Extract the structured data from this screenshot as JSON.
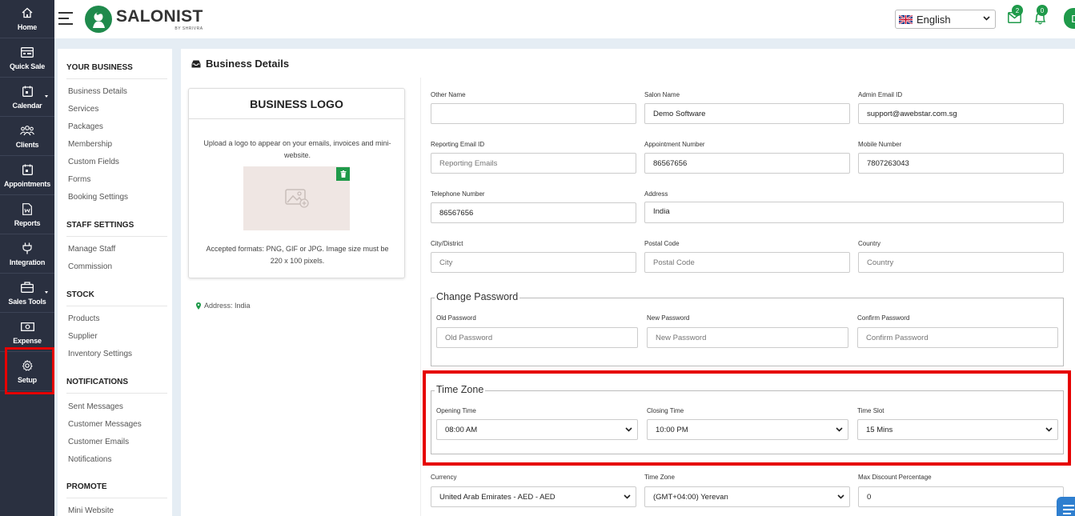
{
  "nav": {
    "items": [
      {
        "label": "Home",
        "icon": "home-icon"
      },
      {
        "label": "Quick Sale",
        "icon": "cash-register-icon"
      },
      {
        "label": "Calendar",
        "icon": "calendar-icon"
      },
      {
        "label": "Clients",
        "icon": "users-icon"
      },
      {
        "label": "Appointments",
        "icon": "appointment-icon"
      },
      {
        "label": "Reports",
        "icon": "report-icon"
      },
      {
        "label": "Integration",
        "icon": "plug-icon"
      },
      {
        "label": "Sales Tools",
        "icon": "briefcase-icon"
      },
      {
        "label": "Expense",
        "icon": "money-icon"
      },
      {
        "label": "Setup",
        "icon": "gear-icon"
      }
    ]
  },
  "header": {
    "logo_name": "SALONIST",
    "logo_sub": "BY SHRIVRA",
    "language": "English",
    "mail_count": "2",
    "notification_count": "0",
    "avatar_initial": "D"
  },
  "sidebar": {
    "sections": [
      {
        "title": "YOUR BUSINESS",
        "links": [
          "Business Details",
          "Services",
          "Packages",
          "Membership",
          "Custom Fields",
          "Forms",
          "Booking Settings"
        ]
      },
      {
        "title": "STAFF SETTINGS",
        "links": [
          "Manage Staff",
          "Commission"
        ]
      },
      {
        "title": "STOCK",
        "links": [
          "Products",
          "Supplier",
          "Inventory Settings"
        ]
      },
      {
        "title": "NOTIFICATIONS",
        "links": [
          "Sent Messages",
          "Customer Messages",
          "Customer Emails",
          "Notifications"
        ]
      },
      {
        "title": "PROMOTE",
        "links": [
          "Mini Website"
        ]
      }
    ]
  },
  "main": {
    "title": "Business Details",
    "logo_card": {
      "title": "BUSINESS LOGO",
      "description": "Upload a logo to appear on your emails, invoices and mini-website.",
      "formats": "Accepted formats: PNG, GIF or JPG. Image size must be 220 x 100 pixels."
    },
    "address_line": "Address: India"
  },
  "form": {
    "other_name": {
      "label": "Other Name",
      "value": "",
      "placeholder": ""
    },
    "salon_name": {
      "label": "Salon Name",
      "value": "Demo Software"
    },
    "admin_email": {
      "label": "Admin Email ID",
      "value": "support@awebstar.com.sg"
    },
    "reporting_email": {
      "label": "Reporting Email ID",
      "placeholder": "Reporting Emails"
    },
    "appointment_number": {
      "label": "Appointment Number",
      "value": "86567656"
    },
    "mobile_number": {
      "label": "Mobile Number",
      "value": "7807263043"
    },
    "telephone_number": {
      "label": "Telephone Number",
      "value": "86567656"
    },
    "address": {
      "label": "Address",
      "value": "India"
    },
    "city": {
      "label": "City/District",
      "placeholder": "City"
    },
    "postal_code": {
      "label": "Postal Code",
      "placeholder": "Postal Code"
    },
    "country": {
      "label": "Country",
      "placeholder": "Country"
    },
    "change_password": {
      "legend": "Change Password",
      "old": {
        "label": "Old Password",
        "placeholder": "Old Password"
      },
      "new": {
        "label": "New Password",
        "placeholder": "New Password"
      },
      "confirm": {
        "label": "Confirm Password",
        "placeholder": "Confirm Password"
      }
    },
    "time_zone_section": {
      "legend": "Time Zone",
      "opening": {
        "label": "Opening Time",
        "value": "08:00 AM"
      },
      "closing": {
        "label": "Closing Time",
        "value": "10:00 PM"
      },
      "slot": {
        "label": "Time Slot",
        "value": "15 Mins"
      }
    },
    "currency": {
      "label": "Currency",
      "value": "United Arab Emirates - AED - AED"
    },
    "time_zone": {
      "label": "Time Zone",
      "value": "(GMT+04:00) Yerevan"
    },
    "max_discount": {
      "label": "Max Discount Percentage",
      "value": "0"
    }
  }
}
